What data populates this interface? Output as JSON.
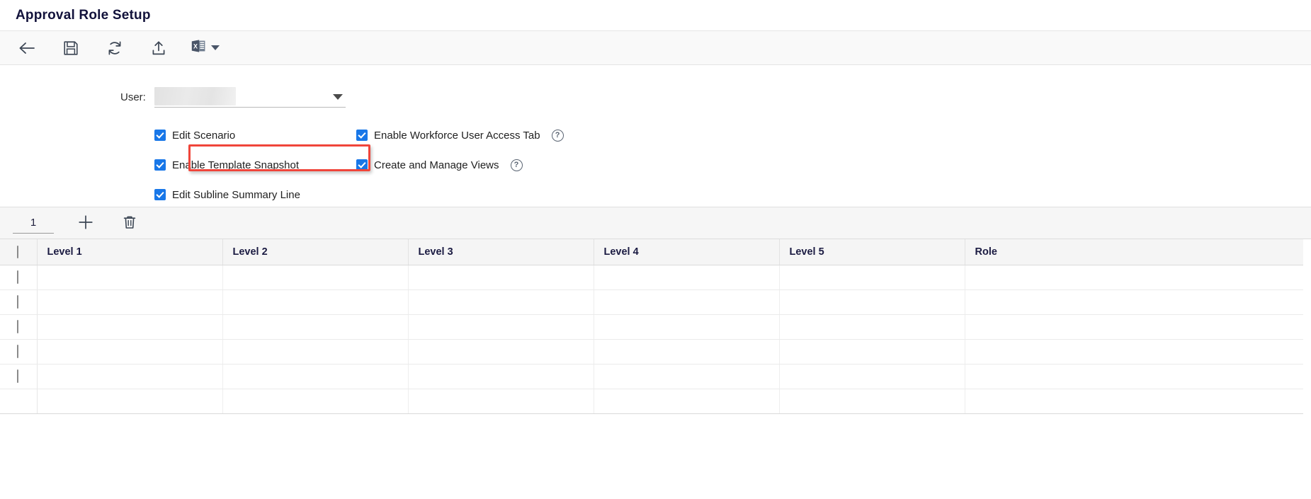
{
  "header": {
    "page_title": "Approval Role Setup"
  },
  "toolbar": {
    "buttons": [
      {
        "name": "back-button",
        "icon": "back-arrow-icon",
        "label": "Back"
      },
      {
        "name": "save-button",
        "icon": "save-disk-icon",
        "label": "Save"
      },
      {
        "name": "refresh-button",
        "icon": "refresh-icon",
        "label": "Refresh"
      },
      {
        "name": "upload-button",
        "icon": "upload-icon",
        "label": "Upload"
      },
      {
        "name": "excel-export-button",
        "icon": "excel-icon",
        "label": "Export to Excel"
      }
    ]
  },
  "form": {
    "user_label": "User:",
    "user_value": "",
    "user_placeholder": "",
    "checkboxes_left": [
      {
        "label": "Edit Scenario",
        "checked": true,
        "help": false
      },
      {
        "label": "Enable Template Snapshot",
        "checked": true,
        "help": false
      },
      {
        "label": "Edit Subline Summary Line",
        "checked": true,
        "help": false
      }
    ],
    "checkboxes_right": [
      {
        "label": "Enable Workforce User Access Tab",
        "checked": true,
        "help": true,
        "help_glyph": "?"
      },
      {
        "label": "Create and Manage Views",
        "checked": true,
        "help": true,
        "help_glyph": "?",
        "highlighted": true
      }
    ]
  },
  "grid_toolbar": {
    "row_count_value": "1",
    "add_button_label": "Add",
    "delete_button_label": "Delete"
  },
  "grid": {
    "columns": [
      "Level 1",
      "Level 2",
      "Level 3",
      "Level 4",
      "Level 5",
      "Role"
    ],
    "rows": [
      {
        "selected": false,
        "cells": [
          "",
          "",
          "",
          "",
          "",
          ""
        ]
      },
      {
        "selected": false,
        "cells": [
          "",
          "",
          "",
          "",
          "",
          ""
        ]
      },
      {
        "selected": false,
        "cells": [
          "",
          "",
          "",
          "",
          "",
          ""
        ]
      },
      {
        "selected": false,
        "cells": [
          "",
          "",
          "",
          "",
          "",
          ""
        ]
      },
      {
        "selected": false,
        "cells": [
          "",
          "",
          "",
          "",
          "",
          ""
        ]
      }
    ]
  },
  "colors": {
    "checkbox_blue": "#1877e8",
    "highlight_red": "#f0453a",
    "cell_caret_purple": "#5a5fd2",
    "title_navy": "#12123b",
    "toolbar_bg": "#f9f9f9"
  }
}
